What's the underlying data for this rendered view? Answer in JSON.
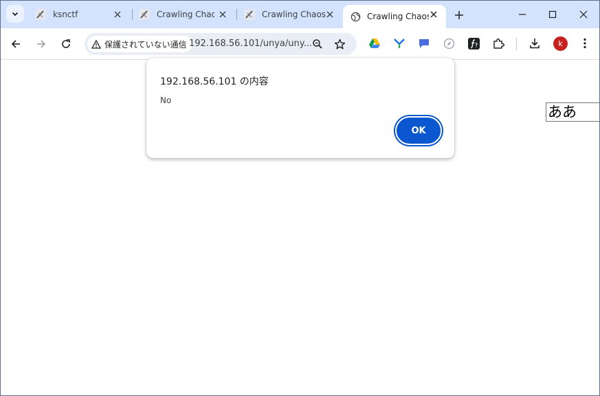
{
  "tabs": [
    {
      "title": "ksnctf",
      "active": false
    },
    {
      "title": "Crawling Chaos",
      "active": false
    },
    {
      "title": "Crawling Chaos",
      "active": false
    },
    {
      "title": "Crawling Chaos",
      "active": true
    }
  ],
  "omnibox": {
    "security_chip": "保護されていない通信",
    "url": "192.168.56.101/unya/uny..."
  },
  "profile": {
    "initial": "k",
    "color": "#c5221f"
  },
  "page": {
    "input_value": "ああ"
  },
  "dialog": {
    "title": "192.168.56.101 の内容",
    "message": "No",
    "ok_label": "OK"
  },
  "colors": {
    "tabstrip": "#d3e3fd",
    "accent": "#0b57d0"
  }
}
